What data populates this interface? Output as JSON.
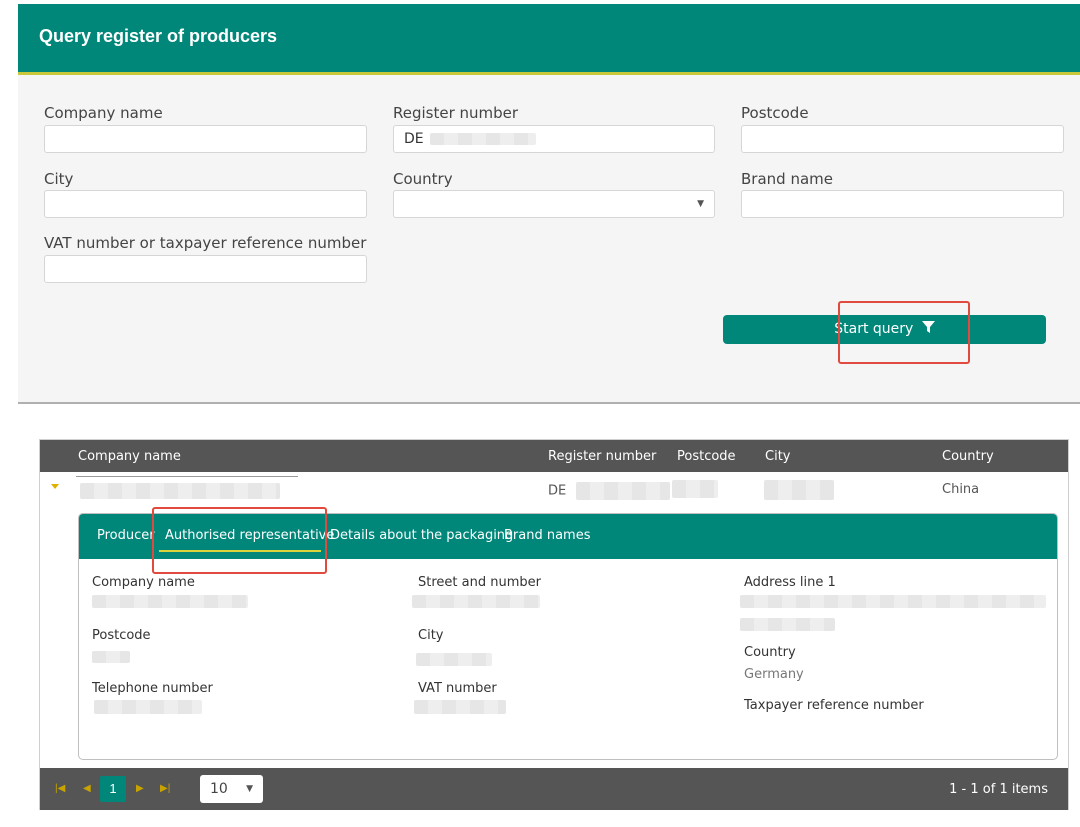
{
  "header": {
    "title": "Query register of producers"
  },
  "form": {
    "company_name": {
      "label": "Company name",
      "value": ""
    },
    "register_number": {
      "label": "Register number",
      "value": "DE"
    },
    "postcode": {
      "label": "Postcode",
      "value": ""
    },
    "city": {
      "label": "City",
      "value": ""
    },
    "country": {
      "label": "Country",
      "value": ""
    },
    "brand_name": {
      "label": "Brand name",
      "value": ""
    },
    "vat_number": {
      "label": "VAT number or taxpayer reference number",
      "value": ""
    },
    "start_query_label": "Start query",
    "filter_icon": "filter-icon"
  },
  "grid": {
    "columns": [
      "Company name",
      "Register number",
      "Postcode",
      "City",
      "Country"
    ],
    "row": {
      "register_number": "DE",
      "country": "China"
    },
    "tabs": [
      "Producer",
      "Authorised representative",
      "Details about the packaging",
      "Brand names"
    ],
    "active_tab": "Authorised representative",
    "detail": {
      "company_name_label": "Company name",
      "street_label": "Street and number",
      "address_line1_label": "Address line 1",
      "postcode_label": "Postcode",
      "city_label": "City",
      "country_label": "Country",
      "country_value": "Germany",
      "telephone_label": "Telephone number",
      "vat_label": "VAT number",
      "taxpayer_label": "Taxpayer reference number"
    }
  },
  "pager": {
    "current_page": "1",
    "page_size": "10",
    "info": "1 - 1 of 1 items"
  },
  "colors": {
    "primary": "#00877a",
    "accent": "#d9d23a",
    "highlight": "#e04a3f",
    "dark": "#555555"
  }
}
